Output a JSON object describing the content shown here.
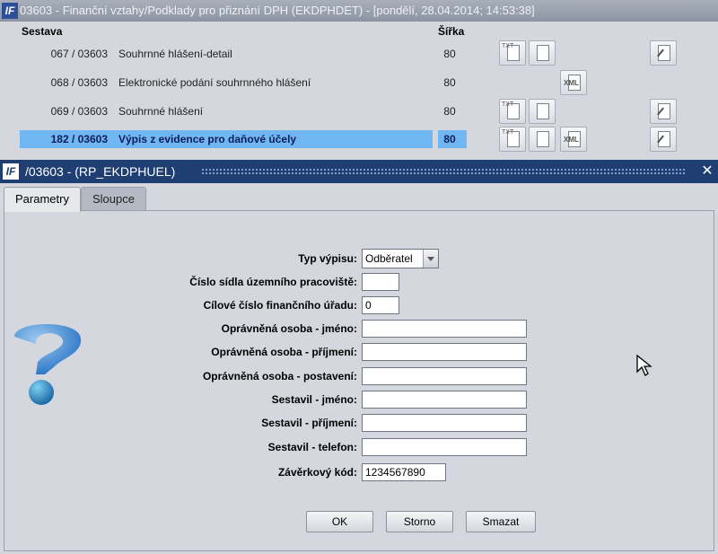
{
  "bg_window": {
    "title": "03603 - Finanční vztahy/Podklady pro přiznání DPH (EKDPHDET) - [pondělí, 28.04.2014; 14:53:38]",
    "app_icon": "tf-logo-icon",
    "headers": {
      "sestava": "Sestava",
      "sirka": "Šířka"
    },
    "rows": [
      {
        "num": "067 / 03603",
        "name": "Souhrnné hlášení-detail",
        "width": "80",
        "selected": false
      },
      {
        "num": "068 / 03603",
        "name": "Elektronické podání souhrnného hlášení",
        "width": "80",
        "selected": false
      },
      {
        "num": "069 / 03603",
        "name": "Souhrnné hlášení",
        "width": "80",
        "selected": false
      },
      {
        "num": "182 / 03603",
        "name": "Výpis z evidence pro daňové účely",
        "width": "80",
        "selected": true
      }
    ],
    "icons": {
      "txt": "TXT",
      "xml": "XML"
    }
  },
  "dialog": {
    "title": "/03603 - (RP_EKDPHUEL)",
    "app_icon": "tf-logo-icon",
    "close_glyph": "✕",
    "tabs": [
      {
        "label": "Parametry",
        "active": true
      },
      {
        "label": "Sloupce",
        "active": false
      }
    ],
    "form": {
      "typ_vypisu": {
        "label": "Typ výpisu:",
        "value": "Odběratel"
      },
      "cislo_sidla": {
        "label": "Číslo sídla územního pracoviště:",
        "value": ""
      },
      "cilove_cislo": {
        "label": "Cílové číslo finančního úřadu:",
        "value": "0"
      },
      "op_jmeno": {
        "label": "Oprávněná osoba - jméno:",
        "value": ""
      },
      "op_prijmeni": {
        "label": "Oprávněná osoba - příjmení:",
        "value": ""
      },
      "op_postaveni": {
        "label": "Oprávněná osoba - postavení:",
        "value": ""
      },
      "sest_jmeno": {
        "label": "Sestavil - jméno:",
        "value": ""
      },
      "sest_prijmeni": {
        "label": "Sestavil - příjmení:",
        "value": ""
      },
      "sest_telefon": {
        "label": "Sestavil - telefon:",
        "value": ""
      },
      "zaverkovy_kod": {
        "label": "Závěrkový kód:",
        "value": "1234567890"
      }
    },
    "buttons": {
      "ok": "OK",
      "storno": "Storno",
      "smazat": "Smazat"
    }
  },
  "colors": {
    "dialog_title_bg": "#1f3f72",
    "selected_row": "#6fb6f2"
  }
}
